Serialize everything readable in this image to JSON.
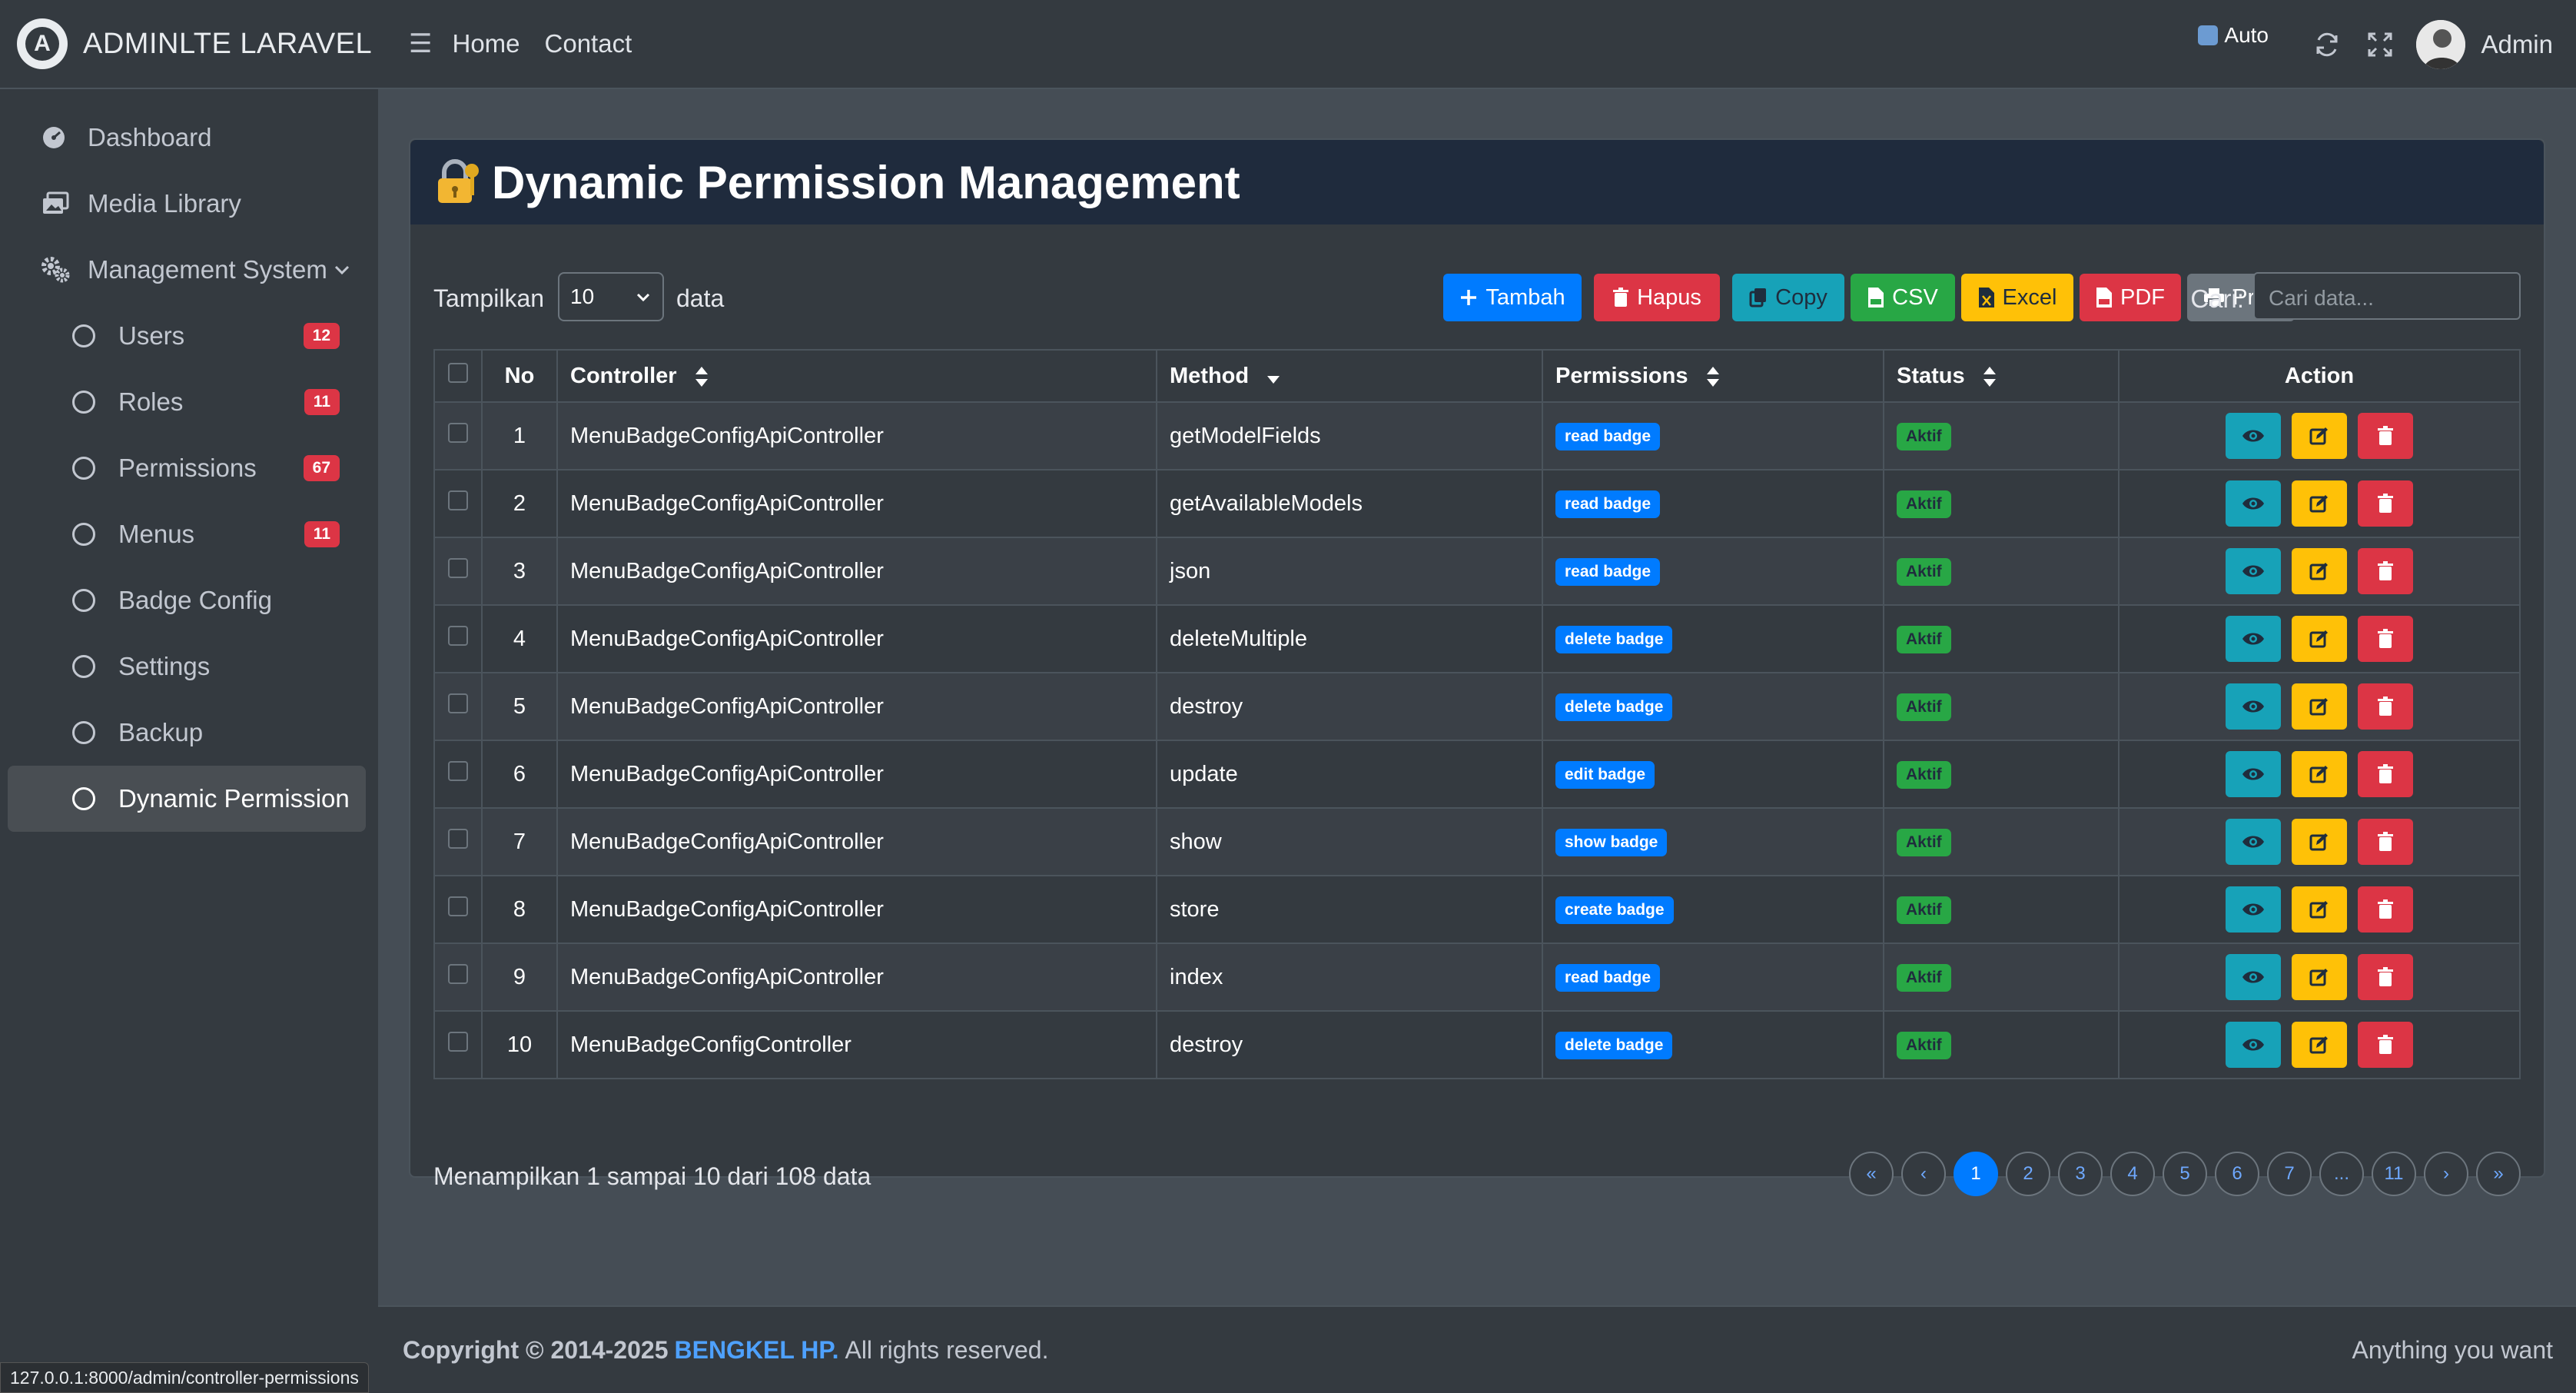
{
  "brand": {
    "logo_letter": "A",
    "name": "ADMINLTE LARAVEL"
  },
  "sidebar": {
    "items": [
      {
        "label": "Dashboard",
        "icon": "dashboard-icon"
      },
      {
        "label": "Media Library",
        "icon": "images-icon"
      },
      {
        "label": "Management System",
        "icon": "cogs-icon"
      },
      {
        "label": "Users",
        "badge": "12"
      },
      {
        "label": "Roles",
        "badge": "11"
      },
      {
        "label": "Permissions",
        "badge": "67"
      },
      {
        "label": "Menus",
        "badge": "11"
      },
      {
        "label": "Badge Config"
      },
      {
        "label": "Settings"
      },
      {
        "label": "Backup"
      },
      {
        "label": "Dynamic Permission"
      }
    ]
  },
  "topbar": {
    "menu_icon": "☰",
    "home": "Home",
    "contact": "Contact",
    "auto_label": "Auto",
    "user_name": "Admin"
  },
  "card": {
    "title": "Dynamic Permission Management"
  },
  "toolbar": {
    "show_label": "Tampilkan",
    "page_size": "10",
    "data_label": "data",
    "add": "Tambah",
    "delete": "Hapus",
    "copy": "Copy",
    "csv": "CSV",
    "excel": "Excel",
    "pdf": "PDF",
    "print": "Print",
    "search_label": "Cari:",
    "search_placeholder": "Cari data..."
  },
  "table": {
    "headers": {
      "no": "No",
      "controller": "Controller",
      "method": "Method",
      "permissions": "Permissions",
      "status": "Status",
      "action": "Action"
    },
    "rows": [
      {
        "no": "1",
        "controller": "MenuBadgeConfigApiController",
        "method": "getModelFields",
        "permission": "read badge",
        "status": "Aktif"
      },
      {
        "no": "2",
        "controller": "MenuBadgeConfigApiController",
        "method": "getAvailableModels",
        "permission": "read badge",
        "status": "Aktif"
      },
      {
        "no": "3",
        "controller": "MenuBadgeConfigApiController",
        "method": "json",
        "permission": "read badge",
        "status": "Aktif"
      },
      {
        "no": "4",
        "controller": "MenuBadgeConfigApiController",
        "method": "deleteMultiple",
        "permission": "delete badge",
        "status": "Aktif"
      },
      {
        "no": "5",
        "controller": "MenuBadgeConfigApiController",
        "method": "destroy",
        "permission": "delete badge",
        "status": "Aktif"
      },
      {
        "no": "6",
        "controller": "MenuBadgeConfigApiController",
        "method": "update",
        "permission": "edit badge",
        "status": "Aktif"
      },
      {
        "no": "7",
        "controller": "MenuBadgeConfigApiController",
        "method": "show",
        "permission": "show badge",
        "status": "Aktif"
      },
      {
        "no": "8",
        "controller": "MenuBadgeConfigApiController",
        "method": "store",
        "permission": "create badge",
        "status": "Aktif"
      },
      {
        "no": "9",
        "controller": "MenuBadgeConfigApiController",
        "method": "index",
        "permission": "read badge",
        "status": "Aktif"
      },
      {
        "no": "10",
        "controller": "MenuBadgeConfigController",
        "method": "destroy",
        "permission": "delete badge",
        "status": "Aktif"
      }
    ]
  },
  "pagination": {
    "info": "Menampilkan 1 sampai 10 dari 108 data",
    "pages": [
      "«",
      "‹",
      "1",
      "2",
      "3",
      "4",
      "5",
      "6",
      "7",
      "...",
      "11",
      "›",
      "»"
    ],
    "active": "1"
  },
  "footer": {
    "copyright": "Copyright © 2014-2025",
    "brand": "BENGKEL HP.",
    "rights": "All rights reserved.",
    "right_text": "Anything you want"
  },
  "statusbar": {
    "url": "127.0.0.1:8000/admin/controller-permissions"
  },
  "colors": {
    "primary": "#007bff",
    "danger": "#dc3545",
    "info": "#17a2b8",
    "success": "#28a745",
    "warning": "#ffc107",
    "secondary": "#6c757d"
  }
}
